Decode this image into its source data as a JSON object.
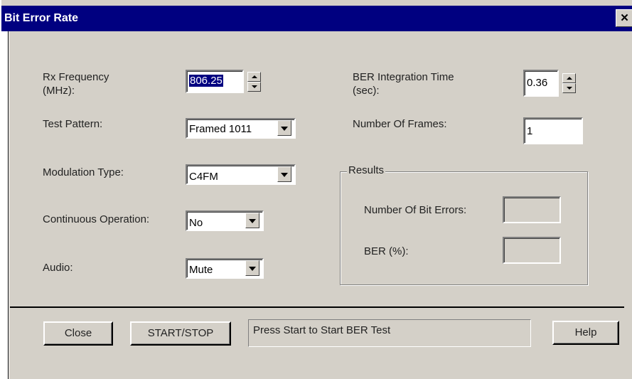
{
  "window": {
    "title": "Bit Error Rate",
    "close_glyph": "✕"
  },
  "fields": {
    "rx_frequency": {
      "label": "Rx Frequency\n(MHz):",
      "value": "806.25"
    },
    "test_pattern": {
      "label": "Test Pattern:",
      "value": "Framed 1011"
    },
    "modulation_type": {
      "label": "Modulation Type:",
      "value": "C4FM"
    },
    "continuous_operation": {
      "label": "Continuous Operation:",
      "value": "No"
    },
    "audio": {
      "label": "Audio:",
      "value": "Mute"
    },
    "ber_integration_time": {
      "label": "BER Integration Time\n(sec):",
      "value": "0.36"
    },
    "number_of_frames": {
      "label": "Number Of Frames:",
      "value": "1"
    }
  },
  "results": {
    "title": "Results",
    "bit_errors_label": "Number Of Bit Errors:",
    "bit_errors_value": "",
    "ber_label": "BER (%):",
    "ber_value": ""
  },
  "buttons": {
    "close": "Close",
    "start_stop": "START/STOP",
    "help": "Help"
  },
  "status": {
    "message": "Press Start to Start BER Test"
  },
  "icons": {
    "spin_up": "spin-up-icon",
    "spin_down": "spin-down-icon",
    "dropdown": "chevron-down-icon",
    "close": "close-icon"
  },
  "colors": {
    "titlebar": "#000080",
    "face": "#d4d0c8",
    "selection": "#000080"
  }
}
